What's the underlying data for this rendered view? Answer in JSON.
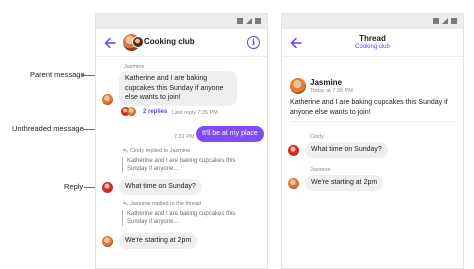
{
  "callouts": {
    "parent": "Parent message",
    "unthreaded": "Unthreaded message",
    "reply": "Reply"
  },
  "chat": {
    "title": "Cooking club",
    "info_icon": "info-icon",
    "back_icon": "arrow-left-icon",
    "parent": {
      "author": "Jasmine",
      "text": "Katherine and I are baking cupcakes this Sunday if anyone else wants to join!",
      "replies": "2 replies",
      "time": "Last reply 7:35 PM"
    },
    "unthreaded": {
      "time": "7:31 PM",
      "text": "It'll be at my place"
    },
    "reply1": {
      "replied_to": "Cindy replied to Jasmine",
      "quote": "Katherine and I are baking cupcakes this Sunday if anyone...",
      "text": "What time on Sunday?"
    },
    "reply2": {
      "replied_to": "Jasmine replied to the thread",
      "quote": "Katherine and I are baking cupcakes this Sunday if anyone...",
      "text": "We're starting at 2pm"
    }
  },
  "thread": {
    "title": "Thread",
    "subtitle": "Cooking club",
    "back_icon": "arrow-left-icon",
    "parent": {
      "author": "Jasmine",
      "time": "Today at 7:30 PM",
      "text": "Katherine and I are baking cupcakes this Sunday if anyone else wants to join!"
    },
    "reply1": {
      "author": "Cindy",
      "text": "What time on Sunday?"
    },
    "reply2": {
      "author": "Jasmine",
      "text": "We're starting at 2pm"
    }
  },
  "colors": {
    "accent": "#6c3df0",
    "mine_bubble": "#7d4cf5",
    "callout": "#e2384d"
  }
}
